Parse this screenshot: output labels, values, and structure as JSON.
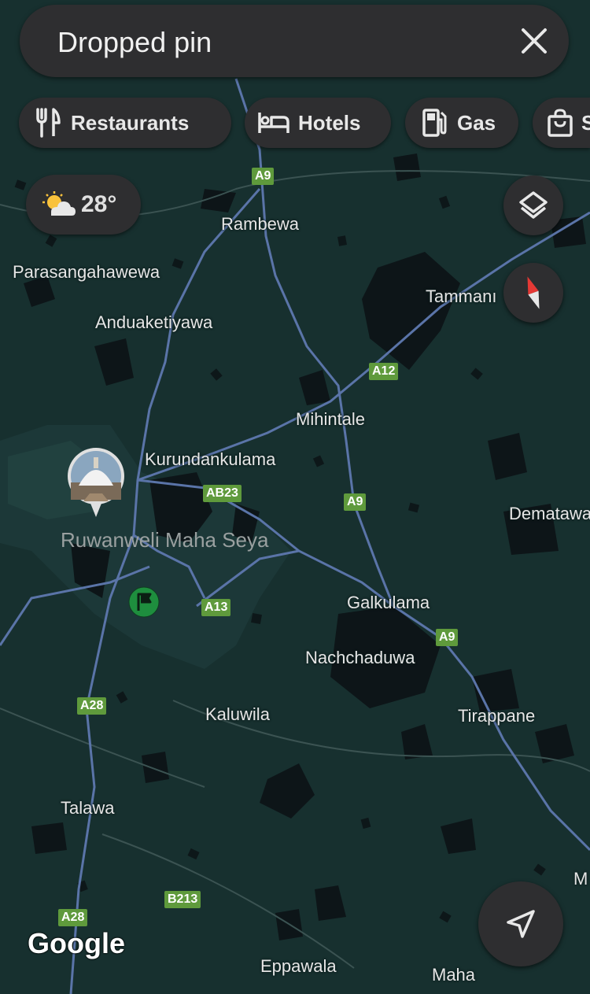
{
  "search": {
    "value": "Dropped pin",
    "clear_icon": "close-icon"
  },
  "chips": [
    {
      "label": "Restaurants",
      "icon": "restaurant-icon"
    },
    {
      "label": "Hotels",
      "icon": "hotel-icon"
    },
    {
      "label": "Gas",
      "icon": "gas-station-icon"
    },
    {
      "label": "S",
      "icon": "shopping-bag-icon"
    }
  ],
  "weather": {
    "temperature": "28°",
    "icon": "partly-cloudy-icon"
  },
  "controls": {
    "layers": "layers-icon",
    "compass": "compass-icon",
    "location": "navigation-arrow-icon"
  },
  "places": {
    "rambewa": "Rambewa",
    "parasangahawewa": "Parasangahawewa",
    "anduaketiyawa": "Anduaketiyawa",
    "tammanna": "Tammanı",
    "mihintale": "Mihintale",
    "kurundankulama": "Kurundankulama",
    "dematawa": "Dematawa",
    "galkulama": "Galkulama",
    "nachchaduwa": "Nachchaduwa",
    "kaluwila": "Kaluwila",
    "tirappane": "Tirappane",
    "talawa": "Talawa",
    "eppawala": "Eppawala",
    "maha": "Maha",
    "m_edge": "M"
  },
  "poi": {
    "label": "Ruwanweli Maha Seya"
  },
  "roads": {
    "a9_top": "A9",
    "a12": "A12",
    "ab23": "AB23",
    "a9_mid": "A9",
    "a13": "A13",
    "a9_low": "A9",
    "a28_upper": "A28",
    "b213": "B213",
    "a28_lower": "A28"
  },
  "branding": {
    "logo": "Google"
  },
  "colors": {
    "map_bg": "#17302f",
    "road": "#5a74a8",
    "panel": "#2e2e30",
    "shield": "#5f9a3c",
    "pin": "#1e8e3e"
  }
}
